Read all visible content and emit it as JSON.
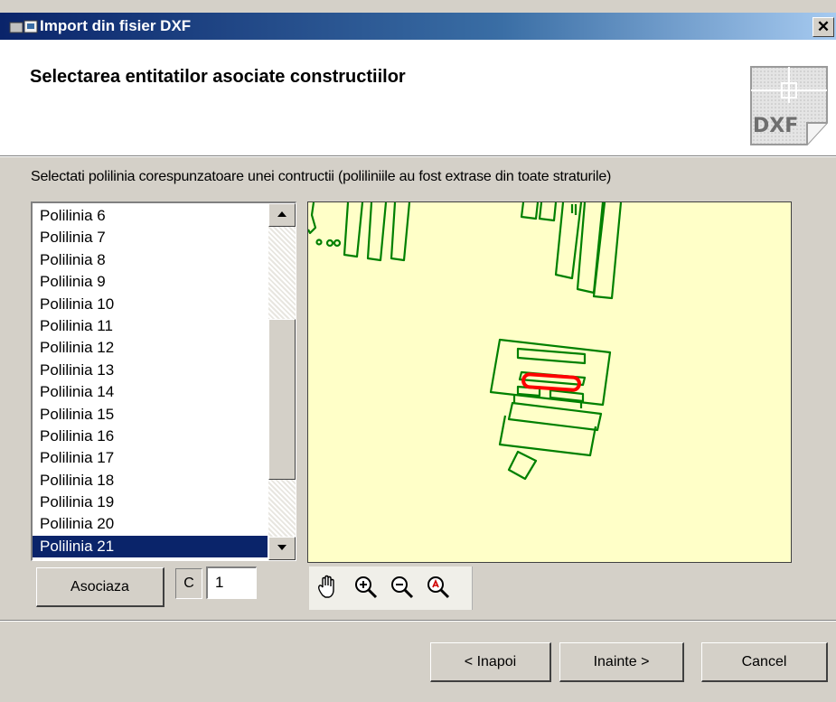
{
  "window": {
    "title": "Import din fisier DXF",
    "close_label": "✕"
  },
  "header": {
    "title": "Selectarea entitatilor asociate constructiilor",
    "logo_text": "DXF"
  },
  "instruction": "Selectati polilinia corespunzatoare unei contructii (poliliniile au fost extrase din toate straturile)",
  "list": {
    "items": [
      "Polilinia 6",
      "Polilinia 7",
      "Polilinia 8",
      "Polilinia 9",
      "Polilinia 10",
      "Polilinia 11",
      "Polilinia 12",
      "Polilinia 13",
      "Polilinia 14",
      "Polilinia 15",
      "Polilinia 16",
      "Polilinia 17",
      "Polilinia 18",
      "Polilinia 19",
      "Polilinia 20",
      "Polilinia 21"
    ],
    "selected": "Polilinia 21",
    "scroll_position": 0.62
  },
  "controls": {
    "associate_label": "Asociaza",
    "c_label": "C",
    "c_value": "1"
  },
  "toolbar": {
    "icons": [
      "pan-hand-icon",
      "zoom-in-icon",
      "zoom-out-icon",
      "zoom-extents-icon"
    ]
  },
  "footer": {
    "back_label": "< Inapoi",
    "next_label": "Inainte >",
    "cancel_label": "Cancel"
  },
  "colors": {
    "canvas_bg": "#ffffc8",
    "polyline": "#008000",
    "selected_polyline": "#ff0000",
    "selection": "#0a246a"
  }
}
